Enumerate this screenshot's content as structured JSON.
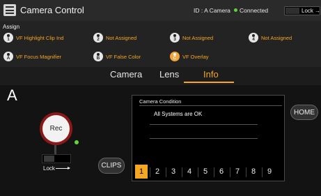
{
  "titlebar": {
    "title": "Camera Control",
    "id_text": "ID : A Camera",
    "connection_status": "Connected",
    "connection_color": "#5fd43a",
    "lock_label": "Lock"
  },
  "assign": {
    "label": "Assign",
    "row1": [
      {
        "key": "1",
        "label": "VF Highlight Clip Ind",
        "style": "white"
      },
      {
        "key": "2",
        "label": "Not Assigned",
        "style": "white"
      },
      {
        "key": "3",
        "label": "Not Assigned",
        "style": "white"
      },
      {
        "key": "4",
        "label": "Not Assigned",
        "style": "white"
      }
    ],
    "row2": [
      {
        "key": "A",
        "label": "VF Focus Magnifier",
        "style": "white"
      },
      {
        "key": "B",
        "label": "VF False Color",
        "style": "white"
      },
      {
        "key": "C",
        "label": "VF Overlay",
        "style": "orange"
      }
    ]
  },
  "tabs": [
    {
      "label": "Camera",
      "active": false
    },
    {
      "label": "Lens",
      "active": false
    },
    {
      "label": "Info",
      "active": true
    }
  ],
  "camera_letter": "A",
  "rec": {
    "label": "Rec",
    "lock_label": "Lock",
    "tally_color": "#61d83a"
  },
  "clips_label": "CLIPS",
  "home_label": "HOME",
  "info": {
    "title": "Camera Condition",
    "message": "All Systems are OK"
  },
  "pages": [
    "1",
    "2",
    "3",
    "4",
    "5",
    "6",
    "7",
    "8",
    "9"
  ],
  "active_page": "1",
  "colors": {
    "accent": "#f5a623",
    "background": "#1c1c1c",
    "rec_ring": "#8a1a1a"
  }
}
